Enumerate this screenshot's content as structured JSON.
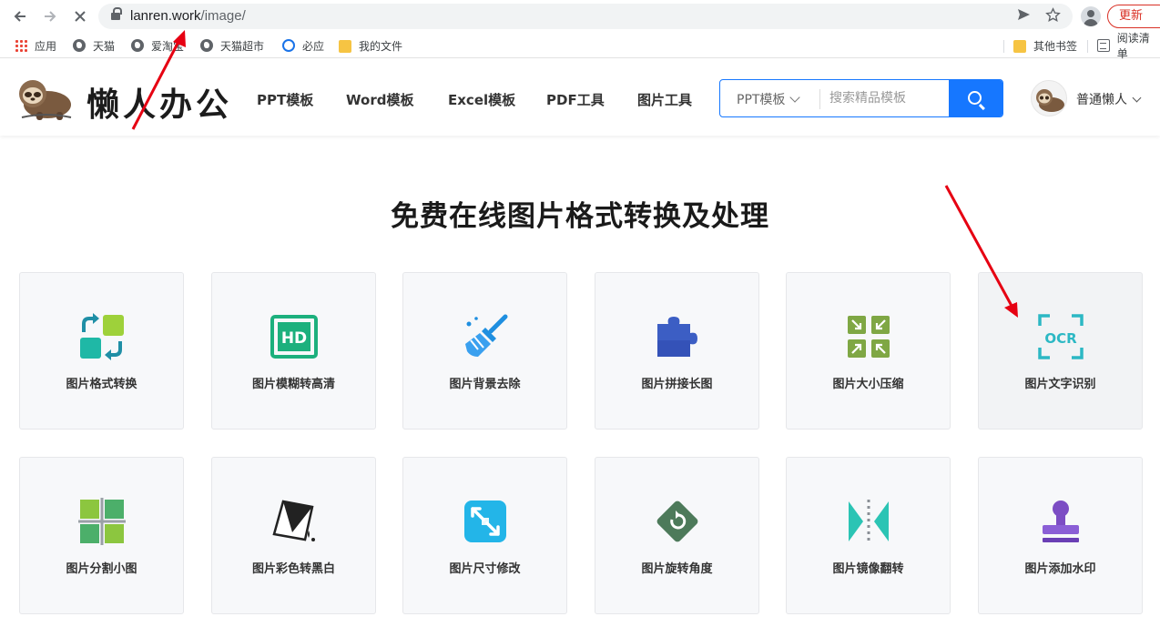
{
  "browser": {
    "url_host": "lanren.work",
    "url_path": "/image/",
    "update_label": "更新",
    "bookmarks": [
      "应用",
      "天猫",
      "爱淘宝",
      "天猫超市",
      "必应",
      "我的文件",
      "其他书签",
      "阅读清单"
    ]
  },
  "site": {
    "logo_text": "懒人办公",
    "nav": [
      "PPT模板",
      "Word模板",
      "Excel模板",
      "PDF工具",
      "图片工具"
    ],
    "search": {
      "category": "PPT模板",
      "placeholder": "搜索精品模板"
    },
    "user_name": "普通懒人"
  },
  "main": {
    "title": "免费在线图片格式转换及处理",
    "tools": [
      {
        "label": "图片格式转换",
        "icon": "format-convert-icon"
      },
      {
        "label": "图片模糊转高清",
        "icon": "hd-icon"
      },
      {
        "label": "图片背景去除",
        "icon": "broom-icon"
      },
      {
        "label": "图片拼接长图",
        "icon": "puzzle-icon"
      },
      {
        "label": "图片大小压缩",
        "icon": "compress-icon"
      },
      {
        "label": "图片文字识别",
        "icon": "ocr-icon"
      },
      {
        "label": "图片分割小图",
        "icon": "grid-split-icon"
      },
      {
        "label": "图片彩色转黑白",
        "icon": "bw-convert-icon"
      },
      {
        "label": "图片尺寸修改",
        "icon": "resize-icon"
      },
      {
        "label": "图片旋转角度",
        "icon": "rotate-icon"
      },
      {
        "label": "图片镜像翻转",
        "icon": "mirror-flip-icon"
      },
      {
        "label": "图片添加水印",
        "icon": "stamp-icon"
      }
    ]
  },
  "colors": {
    "accent": "#1677ff",
    "update_red": "#d93025",
    "annotation_red": "#e60012"
  }
}
